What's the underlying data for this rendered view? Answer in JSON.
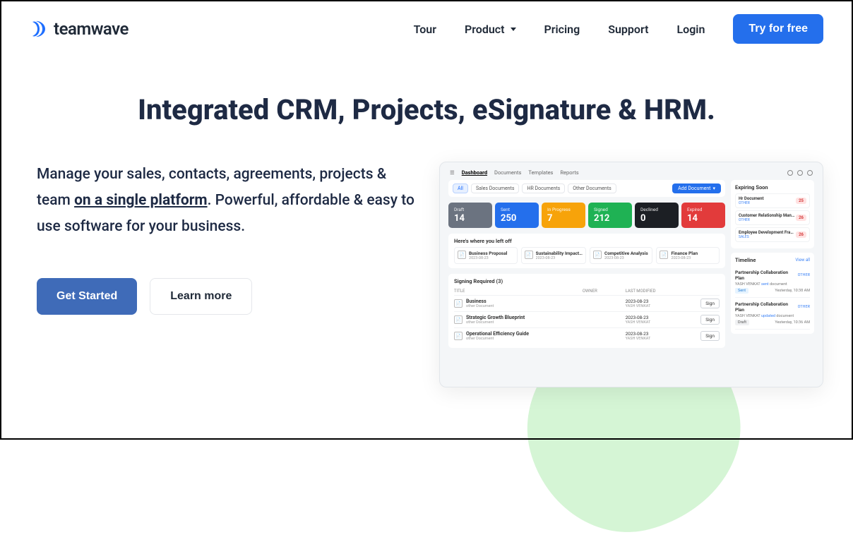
{
  "brand": "teamwave",
  "nav": {
    "tour": "Tour",
    "product": "Product",
    "pricing": "Pricing",
    "support": "Support",
    "login": "Login",
    "cta": "Try for free"
  },
  "hero": {
    "headline": "Integrated CRM, Projects, eSignature & HRM."
  },
  "desc": {
    "line1_pre": "Manage your sales, contacts, agreements, projects & team ",
    "line1_underline": "on a single platform",
    "line1_post": ". Powerful, affordable & easy to use software for your business."
  },
  "cta": {
    "primary": "Get Started",
    "secondary": "Learn more"
  },
  "dashboard": {
    "nav_tabs": [
      "Dashboard",
      "Documents",
      "Templates",
      "Reports"
    ],
    "filter_pills": [
      "All",
      "Sales Documents",
      "HR Documents",
      "Other Documents"
    ],
    "add_doc": "Add Document",
    "stats": [
      {
        "label": "Draft",
        "value": "14",
        "class": "c-draft"
      },
      {
        "label": "Sent",
        "value": "250",
        "class": "c-sent"
      },
      {
        "label": "In Progress",
        "value": "7",
        "class": "c-progress"
      },
      {
        "label": "Signed",
        "value": "212",
        "class": "c-signed"
      },
      {
        "label": "Declined",
        "value": "0",
        "class": "c-declined"
      },
      {
        "label": "Expired",
        "value": "14",
        "class": "c-expired"
      }
    ],
    "leftoff_title": "Here's where you left off",
    "leftoff": [
      {
        "title": "Business Proposal",
        "sub": "2023-08-23"
      },
      {
        "title": "Sustainability Impact…",
        "sub": "2023-08-23"
      },
      {
        "title": "Competitive Analysis",
        "sub": "2023-08-23"
      },
      {
        "title": "Finance Plan",
        "sub": "2023-08-23"
      }
    ],
    "signing_title": "Signing Required (3)",
    "signing_headers": {
      "title": "TITLE",
      "owner": "OWNER",
      "modified": "LAST MODIFIED",
      "action": ""
    },
    "signing_rows": [
      {
        "title": "Business",
        "sub": "other Document",
        "date": "2023-08-23",
        "dsub": "YASH VENKAT",
        "btn": "Sign"
      },
      {
        "title": "Strategic Growth Blueprint",
        "sub": "other Document",
        "date": "2023-08-23",
        "dsub": "YASH VENKAT",
        "btn": "Sign"
      },
      {
        "title": "Operational Efficiency Guide",
        "sub": "other Document",
        "date": "2023-08-23",
        "dsub": "YASH VENKAT",
        "btn": "Sign"
      }
    ],
    "expiring_title": "Expiring Soon",
    "expiring": [
      {
        "title": "Hr Document",
        "sub": "OTHER",
        "badge": "25"
      },
      {
        "title": "Customer Relationship Manageme…",
        "sub": "OTHER",
        "badge": "26"
      },
      {
        "title": "Employee Development Framework",
        "sub": "SALES",
        "badge": "26"
      }
    ],
    "timeline_title": "Timeline",
    "viewall": "View all",
    "timeline": [
      {
        "title": "Partnership Collaboration Plan",
        "sub_pre": "YASH VENKAT ",
        "sub_action": "sent ",
        "sub_post": "document",
        "status": "Sent",
        "time": "Yesterday, 10:38 AM",
        "pill_class": ""
      },
      {
        "title": "Partnership Collaboration Plan",
        "sub_pre": "YASH VENKAT ",
        "sub_action": "updated ",
        "sub_post": "document",
        "status": "Draft",
        "time": "Yesterday, 10:36 AM",
        "pill_class": "draft"
      }
    ],
    "timeline_other": "OTHER"
  }
}
